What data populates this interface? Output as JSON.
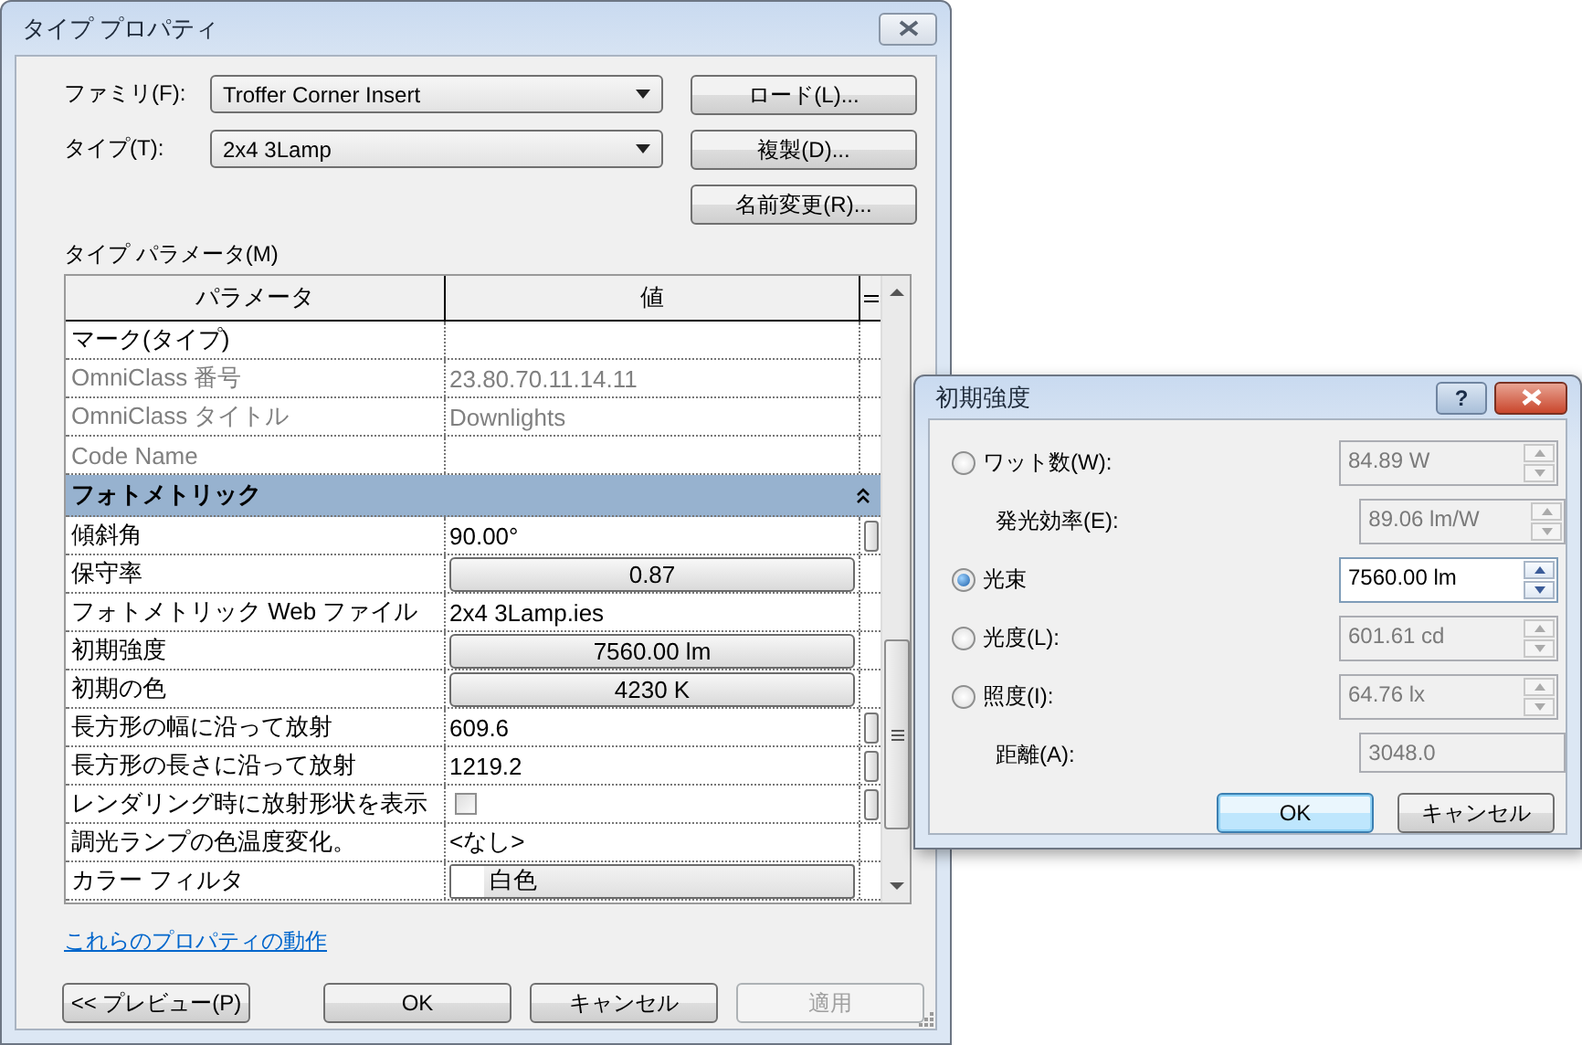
{
  "main_window": {
    "title": "タイプ プロパティ",
    "family": {
      "label": "ファミリ(F):",
      "value": "Troffer Corner Insert"
    },
    "type": {
      "label": "タイプ(T):",
      "value": "2x4 3Lamp"
    },
    "side_buttons": [
      "ロード(L)...",
      "複製(D)...",
      "名前変更(R)..."
    ],
    "params_label": "タイプ パラメータ(M)",
    "table": {
      "columns": [
        "パラメータ",
        "値"
      ],
      "rows": [
        {
          "kind": "text",
          "parameter": "マーク(タイプ)",
          "value": "",
          "disabled": false,
          "handle": false
        },
        {
          "kind": "text",
          "parameter": "OmniClass 番号",
          "value": "23.80.70.11.14.11",
          "disabled": true,
          "handle": false
        },
        {
          "kind": "text",
          "parameter": "OmniClass タイトル",
          "value": "Downlights",
          "disabled": true,
          "handle": false
        },
        {
          "kind": "text",
          "parameter": "Code Name",
          "value": "",
          "disabled": true,
          "handle": false
        },
        {
          "kind": "group",
          "parameter": "フォトメトリック",
          "expanded": true
        },
        {
          "kind": "text",
          "parameter": "傾斜角",
          "value": "90.00°",
          "disabled": false,
          "handle": true
        },
        {
          "kind": "button",
          "parameter": "保守率",
          "value": "0.87",
          "handle": false
        },
        {
          "kind": "text",
          "parameter": "フォトメトリック Web ファイル",
          "value": "2x4 3Lamp.ies",
          "disabled": false,
          "handle": false
        },
        {
          "kind": "button",
          "parameter": "初期強度",
          "value": "7560.00 lm",
          "handle": false
        },
        {
          "kind": "button",
          "parameter": "初期の色",
          "value": "4230 K",
          "handle": false
        },
        {
          "kind": "text",
          "parameter": "長方形の幅に沿って放射",
          "value": "609.6",
          "disabled": false,
          "handle": true
        },
        {
          "kind": "text",
          "parameter": "長方形の長さに沿って放射",
          "value": "1219.2",
          "disabled": false,
          "handle": true
        },
        {
          "kind": "checkbox",
          "parameter": "レンダリング時に放射形状を表示",
          "checked": false,
          "handle": true
        },
        {
          "kind": "text",
          "parameter": "調光ランプの色温度変化。",
          "value": "<なし>",
          "disabled": false,
          "handle": false
        },
        {
          "kind": "swatch",
          "parameter": "カラー フィルタ",
          "value": "白色",
          "color": "#ffffff",
          "handle": false
        }
      ]
    },
    "link": "これらのプロパティの動作",
    "buttons": [
      {
        "label": "<< プレビュー(P)",
        "disabled": false
      },
      {
        "label": "OK",
        "disabled": false
      },
      {
        "label": "キャンセル",
        "disabled": false
      },
      {
        "label": "適用",
        "disabled": true
      }
    ]
  },
  "intensity_dialog": {
    "title": "初期強度",
    "help": "?",
    "rows": [
      {
        "kind": "radio",
        "label": "ワット数(W):",
        "selected": false,
        "value": "84.89 W",
        "disabled": true,
        "spinner": true
      },
      {
        "kind": "label",
        "label": "発光効率(E):",
        "value": "89.06 lm/W",
        "disabled": true,
        "spinner": true
      },
      {
        "kind": "radio",
        "label": "光束",
        "selected": true,
        "value": "7560.00 lm",
        "disabled": false,
        "spinner": true
      },
      {
        "kind": "radio",
        "label": "光度(L):",
        "selected": false,
        "value": "601.61 cd",
        "disabled": true,
        "spinner": true
      },
      {
        "kind": "radio",
        "label": "照度(I):",
        "selected": false,
        "value": "64.76 lx",
        "disabled": true,
        "spinner": true
      },
      {
        "kind": "label",
        "label": "距離(A):",
        "value": "3048.0",
        "disabled": true,
        "spinner": false
      }
    ],
    "buttons": [
      {
        "label": "OK",
        "default": true
      },
      {
        "label": "キャンセル",
        "default": false
      }
    ]
  }
}
